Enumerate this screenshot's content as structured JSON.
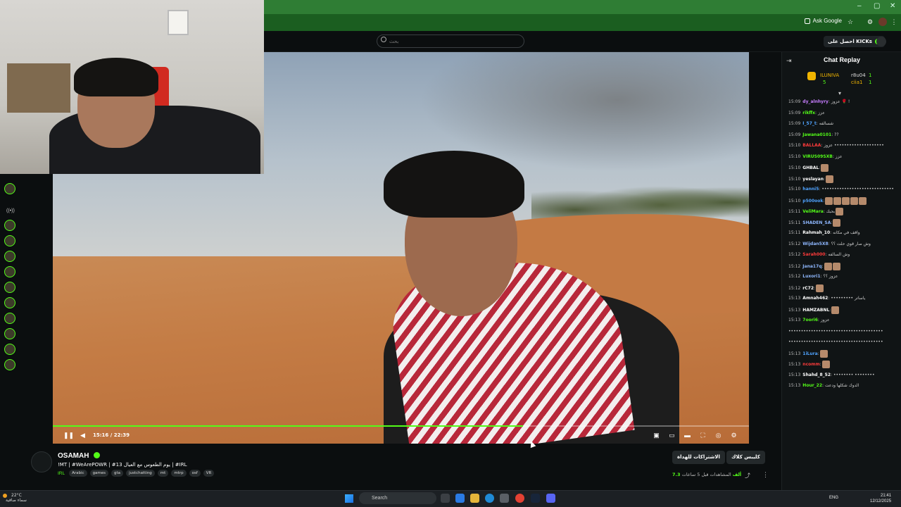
{
  "browser": {
    "ask_google": "Ask Google",
    "controls": [
      "–",
      "▢",
      "✕"
    ]
  },
  "header": {
    "search_placeholder": "بحث",
    "get_kicks_label": "احصل على KICKs"
  },
  "player": {
    "time_label": "15:16 / 22:39",
    "progress_fraction": 0.675
  },
  "chat": {
    "title": "Chat Replay",
    "leaders": [
      {
        "name": "ILUNIVA",
        "count": "5"
      },
      {
        "name": "r8u04",
        "count": "1"
      },
      {
        "name": "ciia1",
        "count": "1"
      }
    ],
    "messages": [
      {
        "time": "15:09",
        "user": "dy_alnhyry",
        "color": "#c77dff",
        "msg": ": عزوز 🌹 !",
        "emotes": 0
      },
      {
        "time": "15:09",
        "user": "rikffx",
        "color": "#53fc18",
        "msg": ": عزز",
        "emotes": 0
      },
      {
        "time": "15:09",
        "user": "I_57_t",
        "color": "#4fa3ff",
        "msg": ": شسالفه",
        "emotes": 0
      },
      {
        "time": "15:09",
        "user": "Jawana0101",
        "color": "#53fc18",
        "msg": ": ??",
        "emotes": 0
      },
      {
        "time": "15:10",
        "user": "BALLAA",
        "color": "#ff3b3b",
        "msg": ": عزوز ••••••••••••••••••••",
        "emotes": 0
      },
      {
        "time": "15:10",
        "user": "VIRUS09SXB",
        "color": "#53fc18",
        "msg": ": عزز",
        "emotes": 0
      },
      {
        "time": "15:10",
        "user": "GHBAL",
        "color": "#ffffff",
        "msg": ":",
        "emotes": 1
      },
      {
        "time": "15:10",
        "user": "yeslayan",
        "color": "#ffffff",
        "msg": ":",
        "emotes": 1
      },
      {
        "time": "15:10",
        "user": "hanni5",
        "color": "#4fa3ff",
        "msg": ": •••••••••••••••••••••••••••••",
        "emotes": 0
      },
      {
        "time": "15:10",
        "user": "p500ook",
        "color": "#4fa3ff",
        "msg": ":",
        "emotes": 5
      },
      {
        "time": "15:11",
        "user": "VeliMara",
        "color": "#53fc18",
        "msg": ": بحبك",
        "emotes": 1
      },
      {
        "time": "15:11",
        "user": "SHADEN_SA",
        "color": "#8fb8ff",
        "msg": ":",
        "emotes": 1
      },
      {
        "time": "15:11",
        "user": "Rahmah_10",
        "color": "#ffffff",
        "msg": ": واقف في مكانه",
        "emotes": 0
      },
      {
        "time": "15:12",
        "user": "Wijdan5X8",
        "color": "#8fb8ff",
        "msg": ": وش صار قوي حلت ؟؟",
        "emotes": 0
      },
      {
        "time": "15:12",
        "user": "Sarah000",
        "color": "#ff3b3b",
        "msg": ": وش السالفه",
        "emotes": 0
      },
      {
        "time": "15:12",
        "user": "Jana17q",
        "color": "#8fb8ff",
        "msg": ":",
        "emotes": 2
      },
      {
        "time": "15:12",
        "user": "Luxori1",
        "color": "#8fb8ff",
        "msg": ": عزوز ؟؟",
        "emotes": 0
      },
      {
        "time": "15:12",
        "user": "rC72",
        "color": "#ffffff",
        "msg": ":",
        "emotes": 1
      },
      {
        "time": "15:13",
        "user": "Amnah462",
        "color": "#ffffff",
        "msg": ": ••••••••• ياساتر",
        "emotes": 0
      },
      {
        "time": "15:13",
        "user": "HAMZABNL",
        "color": "#ffffff",
        "msg": ":",
        "emotes": 1
      },
      {
        "time": "15:13",
        "user": "7oori6",
        "color": "#53fc18",
        "msg": ": عزوز",
        "emotes": 0
      },
      {
        "time": "",
        "user": "",
        "color": "#ffffff",
        "msg": "••••••••••••••••••••••••••••••••••••••",
        "emotes": 0
      },
      {
        "time": "",
        "user": "",
        "color": "#ffffff",
        "msg": "••••••••••••••••••••••••••••••••••••••",
        "emotes": 0
      },
      {
        "time": "15:13",
        "user": "1iLura",
        "color": "#4fa3ff",
        "msg": ":",
        "emotes": 1
      },
      {
        "time": "15:13",
        "user": "ncomm",
        "color": "#ff3b3b",
        "msg": ":",
        "emotes": 1
      },
      {
        "time": "15:13",
        "user": "Shahd_8_52",
        "color": "#ffffff",
        "msg": ": •••••••• ••••••••",
        "emotes": 0
      },
      {
        "time": "15:13",
        "user": "Hour_22",
        "color": "#53fc18",
        "msg": ": الدوك شكلها ودعت",
        "emotes": 0
      }
    ]
  },
  "stream": {
    "streamer_name": "OSAMAH",
    "title": "!MT | #WeArePOWR | #13 يوم الطعوس مع العيال | #IRL",
    "category": "IRL",
    "tags": [
      "Arabic",
      "games",
      "gta",
      "justchatting",
      "mt",
      "mtrp",
      "osf",
      "VR"
    ],
    "clip_label": "كليبس كلاك",
    "subscribe_label": "الاشتراكات للهداة",
    "viewer_count": "7.3 ألف",
    "viewer_suffix": "المشاهدات",
    "time_ago": "قبل 5 ساعات"
  },
  "taskbar": {
    "temperature": "22°C",
    "weather_text": "سماء صافية",
    "search_label": "Search",
    "lang": "ENG",
    "time": "21:41",
    "date": "12/12/2025"
  }
}
